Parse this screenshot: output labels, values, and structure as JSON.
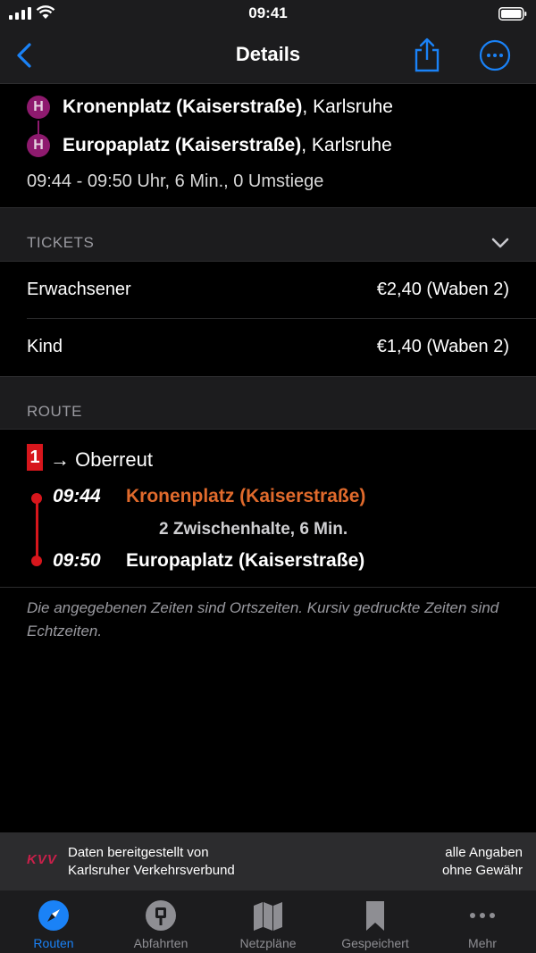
{
  "status_bar": {
    "time": "09:41"
  },
  "nav": {
    "title": "Details"
  },
  "summary": {
    "from_name": "Kronenplatz (Kaiserstraße)",
    "from_city": ", Karlsruhe",
    "to_name": "Europaplatz (Kaiserstraße)",
    "to_city": ", Karlsruhe",
    "stop_icon_letter": "H",
    "info": "09:44 - 09:50 Uhr, 6 Min., 0 Umstiege"
  },
  "tickets": {
    "header": "TICKETS",
    "rows": [
      {
        "label": "Erwachsener",
        "price": "€2,40 (Waben 2)"
      },
      {
        "label": "Kind",
        "price": "€1,40 (Waben 2)"
      }
    ]
  },
  "route": {
    "header": "ROUTE",
    "line": "1",
    "line_color": "#d7161c",
    "direction": "→ Oberreut",
    "departure_time": "09:44",
    "departure_stop": "Kronenplatz (Kaiserstraße)",
    "intermediate": "2 Zwischenhalte, 6 Min.",
    "arrival_time": "09:50",
    "arrival_stop": "Europaplatz (Kaiserstraße)"
  },
  "note": "Die angegebenen Zeiten sind Ortszeiten. Kursiv gedruckte Zeiten sind Echtzeiten.",
  "footer": {
    "logo": "KVV",
    "provider_line1": "Daten bereitgestellt von",
    "provider_line2": "Karlsruher Verkehrsverbund",
    "disclaimer_line1": "alle Angaben",
    "disclaimer_line2": "ohne Gewähr"
  },
  "tabs": [
    {
      "label": "Routen",
      "icon": "compass-icon",
      "active": true
    },
    {
      "label": "Abfahrten",
      "icon": "stop-sign-icon",
      "active": false
    },
    {
      "label": "Netzpläne",
      "icon": "map-icon",
      "active": false
    },
    {
      "label": "Gespeichert",
      "icon": "bookmark-icon",
      "active": false
    },
    {
      "label": "Mehr",
      "icon": "ellipsis-icon",
      "active": false
    }
  ],
  "colors": {
    "accent": "#1a82f7",
    "stop_magenta": "#8e1a6e",
    "highlight_orange": "#e06a2c"
  }
}
